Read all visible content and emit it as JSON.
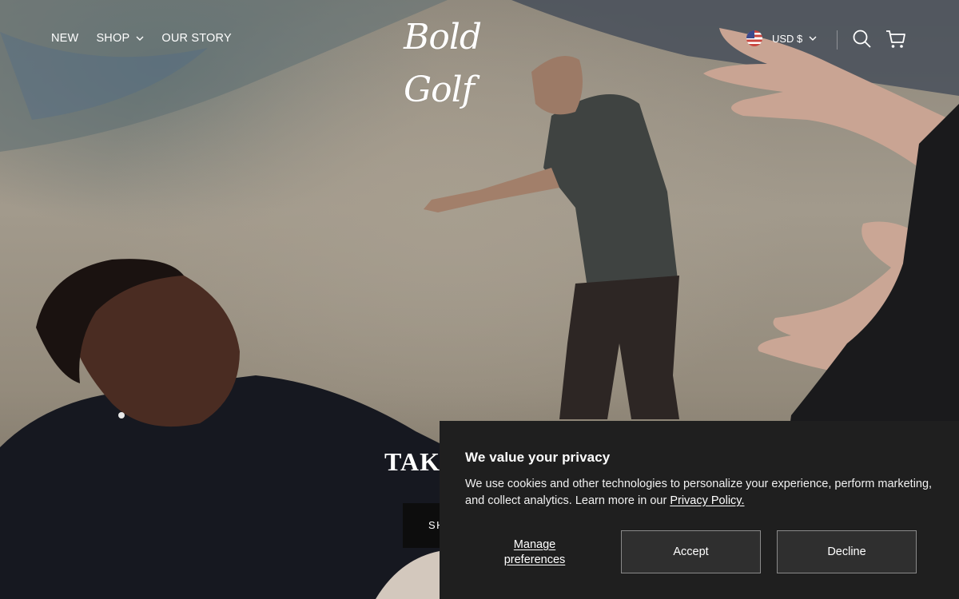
{
  "header": {
    "nav": [
      {
        "label": "NEW"
      },
      {
        "label": "SHOP",
        "has_dropdown": true
      },
      {
        "label": "OUR STORY"
      }
    ],
    "logo_text": "Bold Golf",
    "currency": {
      "label": "USD $",
      "flag": "us-flag-icon"
    },
    "icons": {
      "search": "search-icon",
      "cart": "cart-icon"
    }
  },
  "hero": {
    "heading_visible": "TAKE",
    "cta_visible": "SH"
  },
  "cookie_banner": {
    "title": "We value your privacy",
    "text_before_link": "We use cookies and other technologies to personalize your experience, perform marketing, and collect analytics. Learn more in our ",
    "link_text": "Privacy Policy.",
    "manage_label": "Manage preferences",
    "accept_label": "Accept",
    "decline_label": "Decline"
  },
  "colors": {
    "banner_bg": "#1f1f1f",
    "button_bg": "#2f2f2f",
    "button_border": "#8a8a8a",
    "text": "#ffffff"
  }
}
